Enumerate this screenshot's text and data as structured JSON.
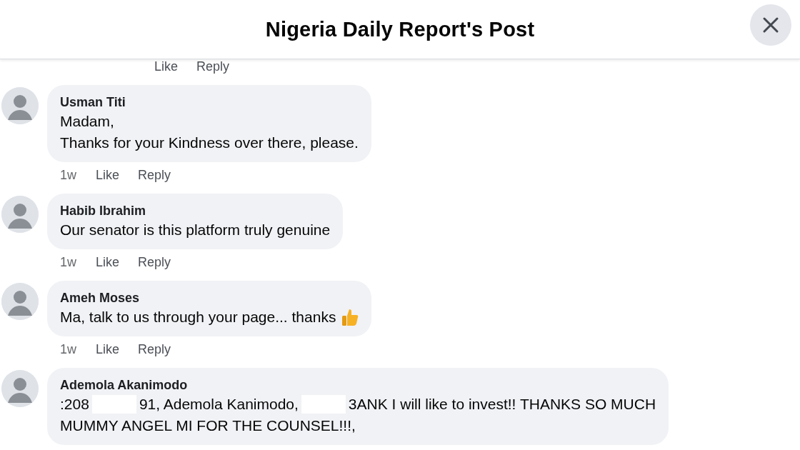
{
  "header": {
    "title": "Nigeria Daily Report's Post"
  },
  "top_actions": [
    "Like",
    "Reply"
  ],
  "comments": [
    {
      "kind": "text",
      "author": "Usman Titi",
      "lines": [
        [
          {
            "kind": "text",
            "text": "Madam,"
          }
        ],
        [
          {
            "kind": "text",
            "text": "Thanks for your Kindness over there, please."
          }
        ]
      ],
      "time": "1w",
      "actions": [
        "Like",
        "Reply"
      ]
    },
    {
      "kind": "text",
      "author": "Habib Ibrahim",
      "lines": [
        [
          {
            "kind": "text",
            "text": "Our senator is this platform truly genuine"
          }
        ]
      ],
      "time": "1w",
      "actions": [
        "Like",
        "Reply"
      ]
    },
    {
      "kind": "thumbs_up",
      "author": "Ameh Moses",
      "lines": [
        [
          {
            "kind": "text",
            "text": "Ma, talk to us through your page... thanks"
          }
        ]
      ],
      "time": "1w",
      "actions": [
        "Like",
        "Reply"
      ]
    },
    {
      "kind": "text",
      "author": "Ademola Akanimodo",
      "lines": [
        [
          {
            "kind": "text",
            "text": ":208"
          },
          {
            "kind": "redacted"
          },
          {
            "kind": "text",
            "text": "91, Ademola Kanimodo,"
          },
          {
            "kind": "redacted"
          },
          {
            "kind": "text",
            "text": "3ANK I will like to invest!! THANKS SO MUCH"
          }
        ],
        [
          {
            "kind": "text",
            "text": "MUMMY ANGEL MI FOR THE COUNSEL!!!,"
          }
        ]
      ]
    }
  ]
}
